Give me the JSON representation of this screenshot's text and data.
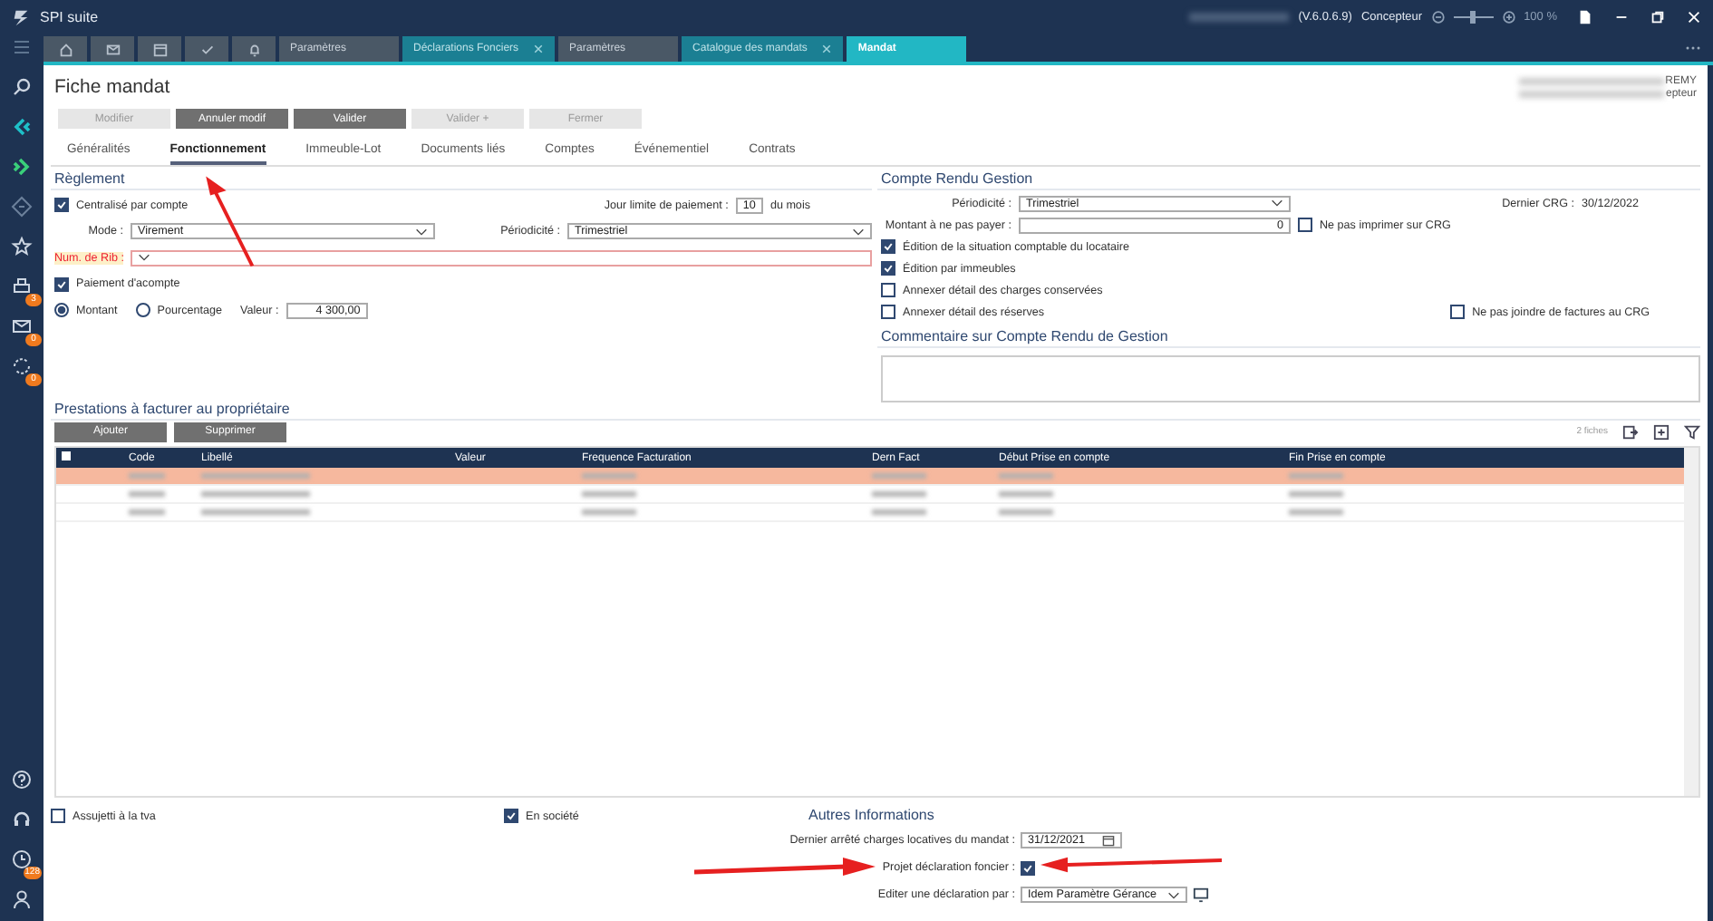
{
  "window": {
    "title": "SPI suite",
    "version": "(V.6.0.6.9)",
    "role": "Concepteur",
    "zoom": {
      "level": 0.5,
      "reading": "100 %"
    }
  },
  "sidebar": {
    "items": [
      {
        "kind": "search"
      },
      {
        "kind": "back"
      },
      {
        "kind": "forward"
      },
      {
        "kind": "diamond"
      },
      {
        "kind": "star"
      },
      {
        "kind": "printer",
        "badge": "3"
      },
      {
        "kind": "mail",
        "badge": "0"
      },
      {
        "kind": "sync",
        "badge": "0"
      },
      {
        "kind": "spacer"
      },
      {
        "kind": "help"
      },
      {
        "kind": "headset"
      },
      {
        "kind": "clock",
        "badge": "128"
      },
      {
        "kind": "user"
      }
    ]
  },
  "tabs": [
    {
      "kind": "home",
      "selected": false
    },
    {
      "kind": "mail",
      "selected": false
    },
    {
      "kind": "calendar",
      "selected": false
    },
    {
      "kind": "check",
      "selected": false
    },
    {
      "kind": "bell",
      "selected": false
    },
    {
      "kind": "text",
      "label": "Paramètres",
      "closable": false,
      "selected": false
    },
    {
      "kind": "text",
      "label": "Déclarations Fonciers",
      "closable": true,
      "selected": false
    },
    {
      "kind": "text",
      "label": "Paramètres",
      "closable": false,
      "selected": false
    },
    {
      "kind": "text",
      "label": "Catalogue des mandats",
      "closable": true,
      "selected": false
    },
    {
      "kind": "text",
      "label": "Mandat",
      "closable": false,
      "selected": true
    }
  ],
  "header": {
    "title": "Fiche mandat",
    "user_lines": [
      "REMY",
      "epteur"
    ],
    "buttons": [
      {
        "label": "Modifier",
        "disabled": true
      },
      {
        "label": "Annuler modif",
        "disabled": false
      },
      {
        "label": "Valider",
        "disabled": false
      },
      {
        "label": "Valider +",
        "disabled": true
      },
      {
        "label": "Fermer",
        "disabled": true
      }
    ]
  },
  "subtabs": [
    {
      "label": "Généralités",
      "selected": false
    },
    {
      "label": "Fonctionnement",
      "selected": true
    },
    {
      "label": "Immeuble-Lot",
      "selected": false
    },
    {
      "label": "Documents liés",
      "selected": false
    },
    {
      "label": "Comptes",
      "selected": false
    },
    {
      "label": "Événementiel",
      "selected": false
    },
    {
      "label": "Contrats",
      "selected": false
    }
  ],
  "reglement": {
    "title": "Règlement",
    "centralise": {
      "label": "Centralisé par compte",
      "checked": true
    },
    "jour_limite": {
      "label": "Jour limite de paiement :",
      "value": "10",
      "suffix": "du mois"
    },
    "mode": {
      "label": "Mode :",
      "value": "Virement"
    },
    "periodicite": {
      "label": "Périodicité :",
      "value": "Trimestriel"
    },
    "rib": {
      "label": "Num. de Rib :",
      "error": true
    },
    "acompte": {
      "label": "Paiement d'acompte",
      "checked": true
    },
    "radios": [
      {
        "label": "Montant",
        "selected": true
      },
      {
        "label": "Pourcentage",
        "selected": false
      }
    ],
    "valeur": {
      "label": "Valeur :",
      "value": "4 300,00"
    }
  },
  "crg": {
    "title": "Compte Rendu Gestion",
    "periodicite": {
      "label": "Périodicité :",
      "value": "Trimestriel"
    },
    "dernier": {
      "label": "Dernier CRG :",
      "value": "30/12/2022"
    },
    "montant": {
      "label": "Montant à ne pas payer :",
      "value": "0"
    },
    "ne_pas_imprimer": {
      "label": "Ne pas imprimer sur CRG",
      "checked": false
    },
    "checks": [
      {
        "label": "Édition de la situation comptable du locataire",
        "checked": true
      },
      {
        "label": "Édition par immeubles",
        "checked": true
      },
      {
        "label": "Annexer détail des charges conservées",
        "checked": false
      },
      {
        "label": "Annexer détail des réserves",
        "checked": false
      }
    ],
    "ne_pas_joindre": {
      "label": "Ne pas joindre de factures au CRG",
      "checked": false
    },
    "comment_title": "Commentaire sur Compte Rendu de Gestion"
  },
  "prestations": {
    "title": "Prestations à facturer au propriétaire",
    "buttons": [
      "Ajouter",
      "Supprimer"
    ],
    "count": "2 fiches",
    "table": {
      "select_all": {
        "checked": false
      },
      "columns": [
        "Code",
        "Libellé",
        "Valeur",
        "Frequence Facturation",
        "Dern Fact",
        "Début Prise en compte",
        "Fin Prise en compte"
      ],
      "rows": [
        {
          "selected": true
        },
        {
          "selected": false
        },
        {
          "selected": false
        }
      ]
    }
  },
  "bottom": {
    "tva": {
      "label": "Assujetti à la tva",
      "checked": false
    },
    "societe": {
      "label": "En société",
      "checked": true
    }
  },
  "autres": {
    "title": "Autres Informations",
    "arrete": {
      "label": "Dernier arrêté charges locatives du mandat :",
      "value": "31/12/2021"
    },
    "projet": {
      "label": "Projet déclaration foncier :",
      "checked": true
    },
    "editer": {
      "label": "Editer une déclaration par :",
      "value": "Idem Paramètre Gérance"
    }
  }
}
